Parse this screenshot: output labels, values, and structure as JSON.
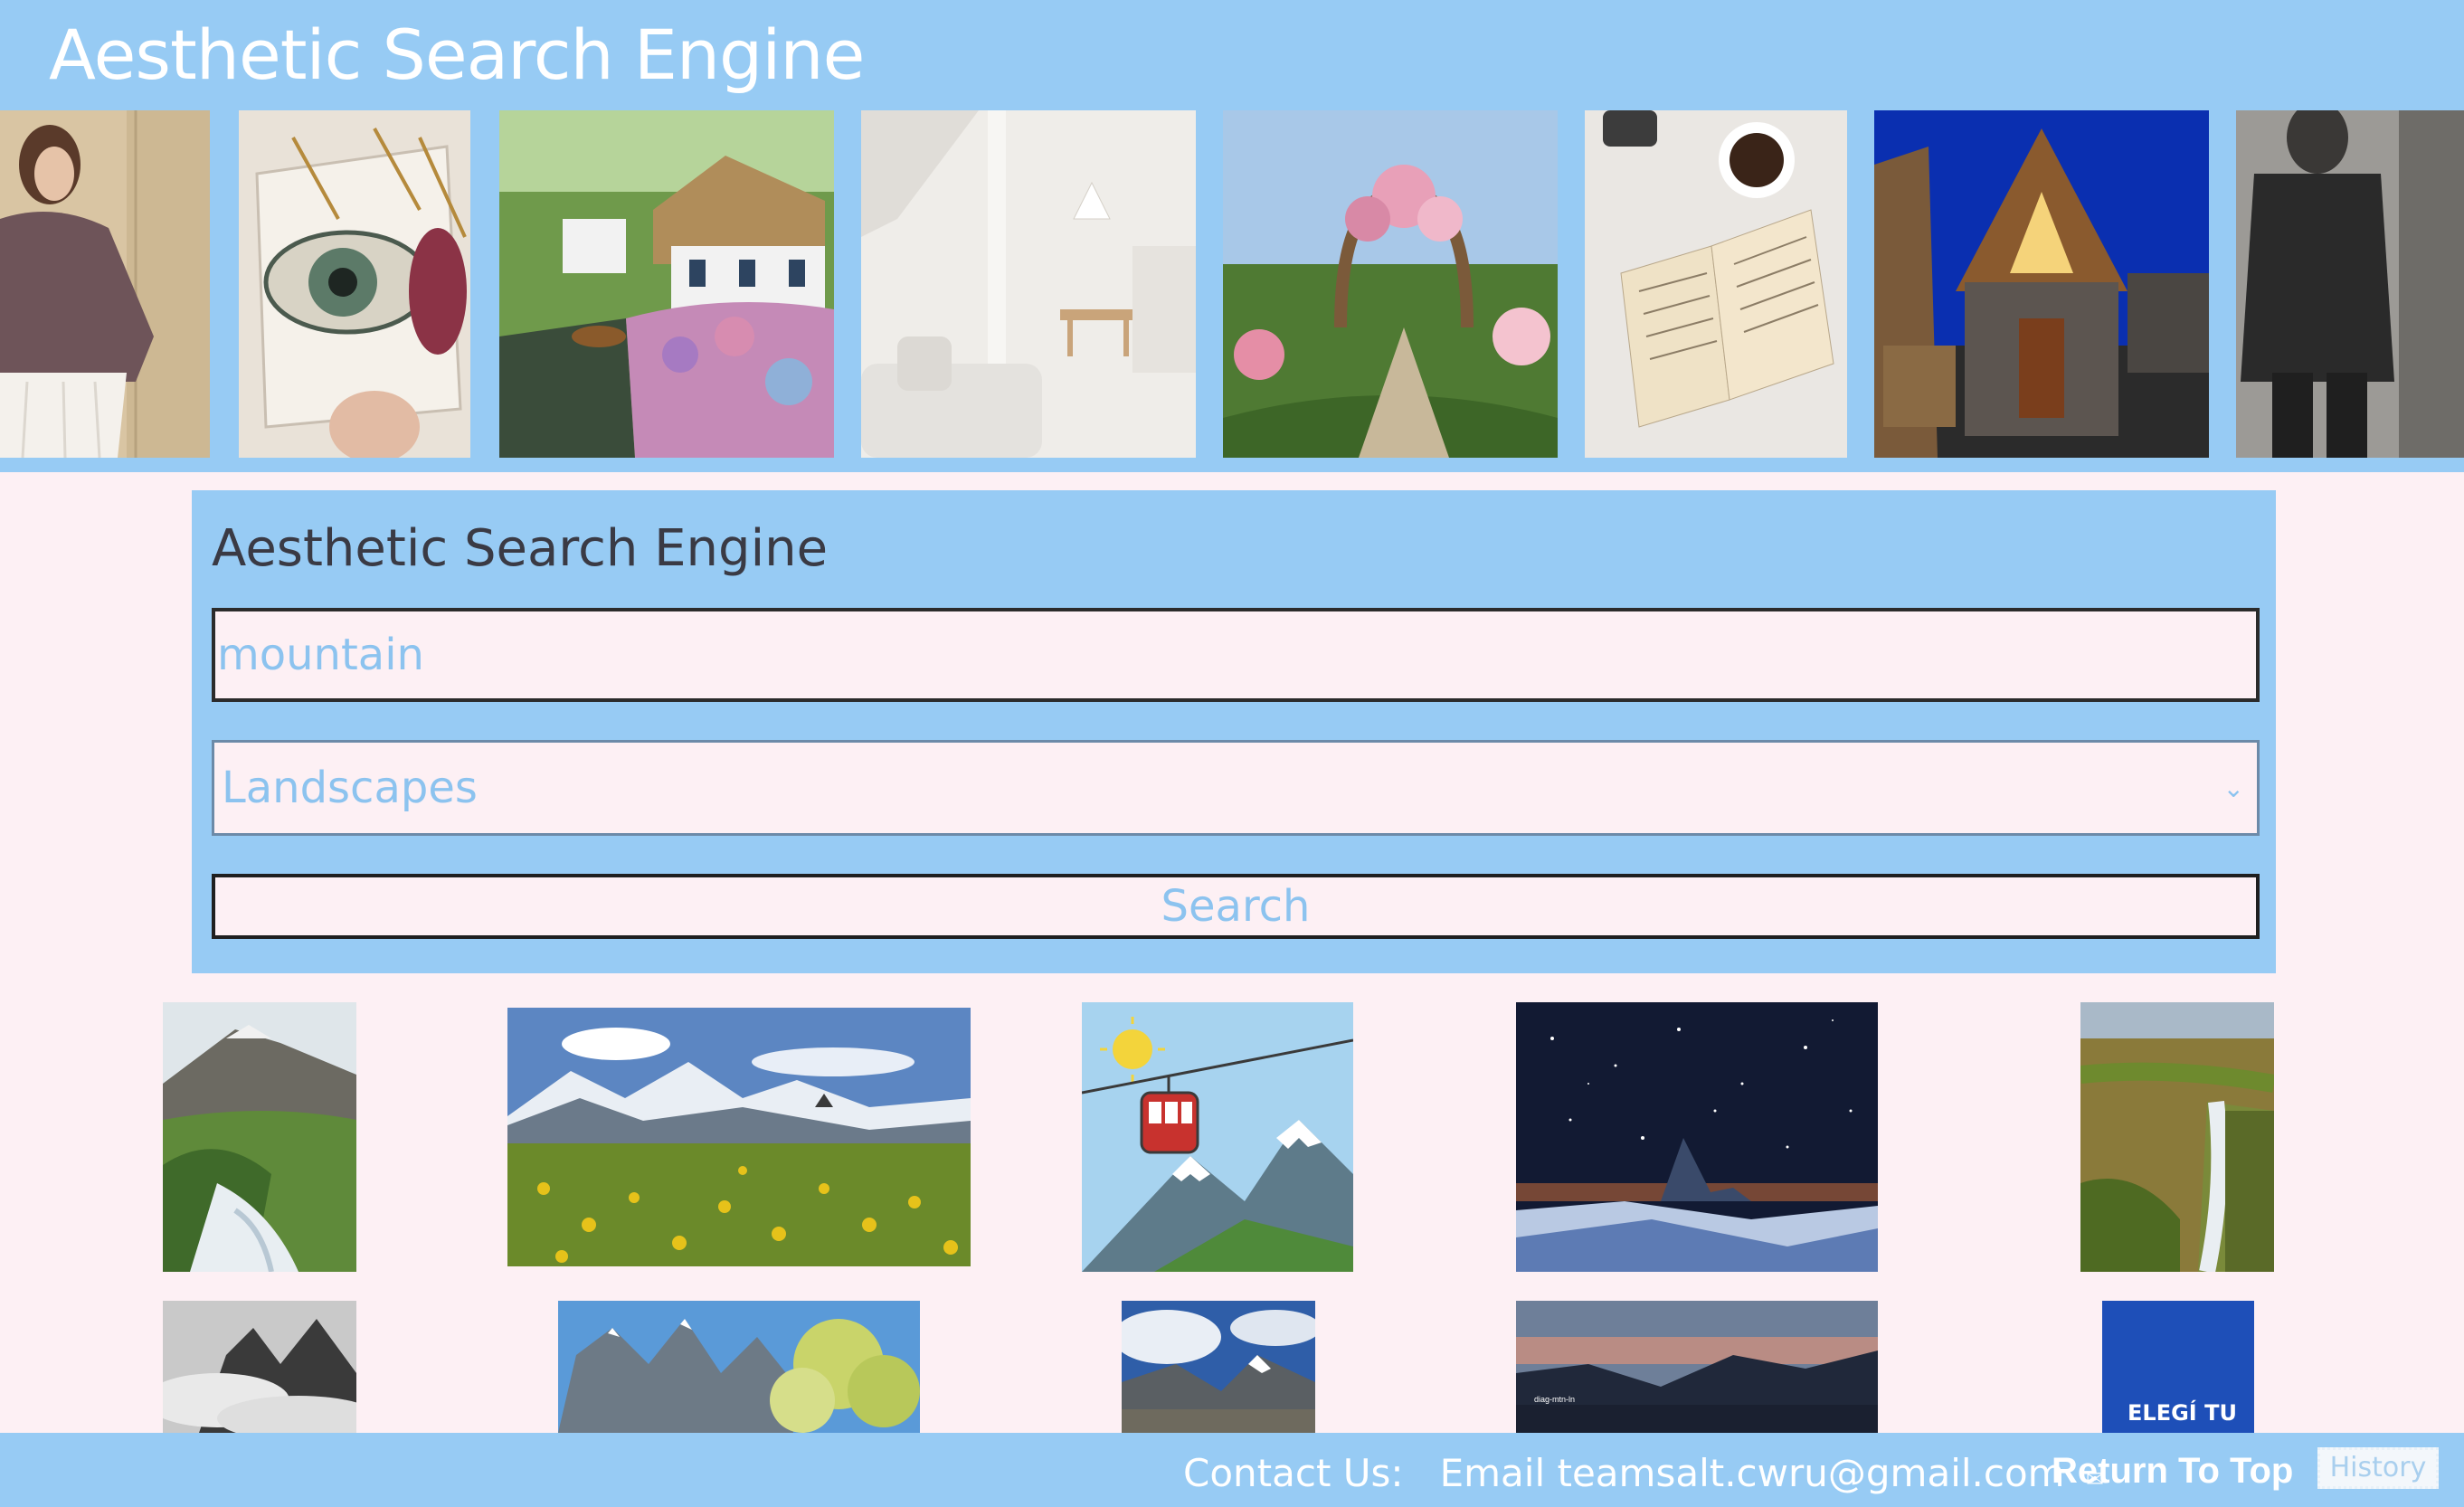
{
  "header": {
    "title": "Aesthetic Search Engine",
    "banner_images": [
      "girl-in-sweater-photo",
      "eye-painting-photo",
      "cottage-canal-garden-photo",
      "white-interior-photo",
      "rose-garden-photo",
      "open-book-coffee-photo",
      "modern-house-night-photo",
      "man-in-dark-coat-photo"
    ]
  },
  "search": {
    "title": "Aesthetic Search Engine",
    "query": "mountain",
    "category": "Landscapes",
    "button_label": "Search"
  },
  "results": [
    "mountain-stream-photo",
    "dandelion-meadow-mountains-photo",
    "cable-car-illustration",
    "starry-night-matterhorn-photo",
    "waterfall-cliff-photo",
    "misty-peaks-photo",
    "rocky-mountains-lake-photo",
    "snowy-range-clouds-photo",
    "sunset-lake-photo",
    "elegi-tu-poster"
  ],
  "result_captions": {
    "sunset_lake_tag": "diag-mtn-ln",
    "poster_text": "ELEGÍ TU"
  },
  "footer": {
    "contact_label": "Contact Us:",
    "email_text": "Email teamsalt.cwru@gmail.com",
    "return_label": "Return To Top",
    "history_label": "History"
  },
  "colors": {
    "header_blue": "#97cbf4",
    "page_background": "#fdf0f4",
    "accent_text": "#8cc3ef"
  }
}
